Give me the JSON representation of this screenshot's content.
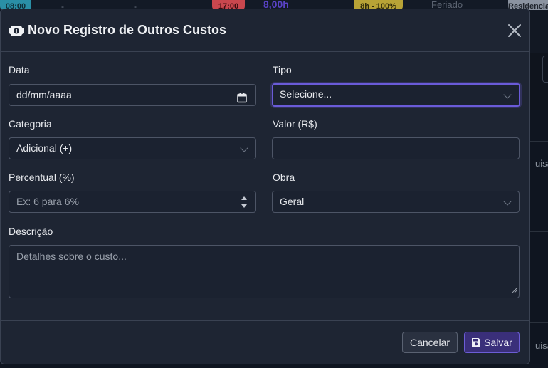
{
  "background": {
    "time_chip": "08:00",
    "dash_1": "-",
    "dash_2": "-",
    "end_chip": "17:00",
    "hours": "8,00h",
    "percent_chip": "8h - 100%",
    "status": "Feriado",
    "tag": "Residencial",
    "side_text_1": "uisa",
    "side_text_2": "uisa"
  },
  "modal": {
    "title": "Novo Registro de Outros Custos",
    "fields": {
      "data": {
        "label": "Data",
        "value": "dd/mm/aaaa"
      },
      "tipo": {
        "label": "Tipo",
        "value": "Selecione..."
      },
      "categoria": {
        "label": "Categoria",
        "value": "Adicional (+)"
      },
      "valor": {
        "label": "Valor (R$)",
        "value": ""
      },
      "percentual": {
        "label": "Percentual (%)",
        "placeholder": "Ex: 6 para 6%"
      },
      "obra": {
        "label": "Obra",
        "value": "Geral"
      },
      "descricao": {
        "label": "Descrição",
        "placeholder": "Detalhes sobre o custo..."
      }
    },
    "buttons": {
      "cancel": "Cancelar",
      "save": "Salvar"
    }
  },
  "colors": {
    "accent": "#6a5bd8",
    "modal_bg": "#1e2533",
    "page_bg": "#0f1520"
  }
}
